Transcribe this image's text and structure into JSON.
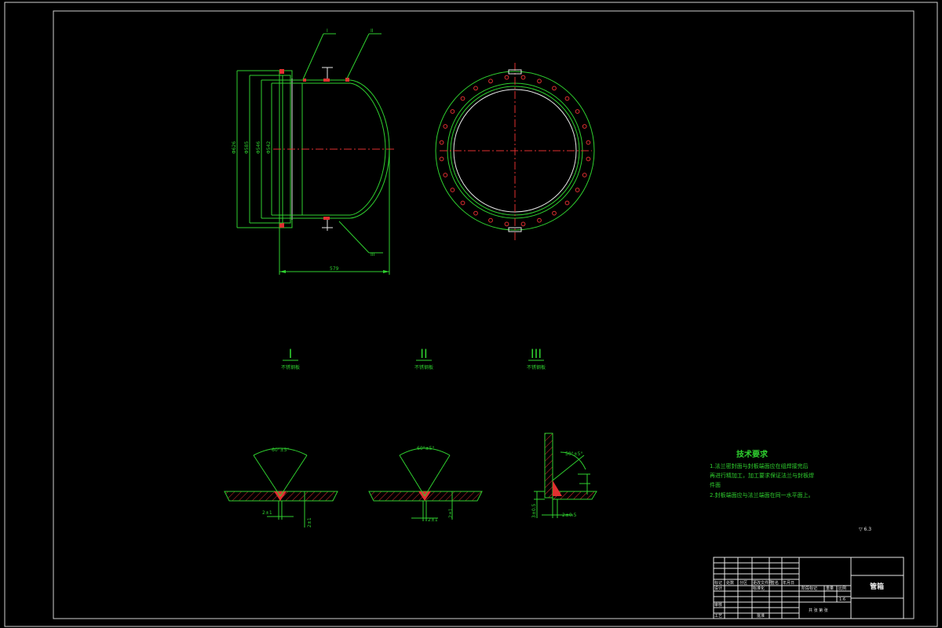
{
  "drawing": {
    "side_view": {
      "dim_outer": "Φ626",
      "dim_2": "Φ585",
      "dim_3": "Φ546",
      "dim_4": "Φ542",
      "dim_length": "579",
      "callout_top_1": "I",
      "callout_top_2": "II",
      "callout_bottom": "III"
    },
    "details": [
      {
        "roman": "I",
        "caption": "不锈钢板",
        "angle": "60°±5°",
        "gap": "2±1",
        "thick": "2±1"
      },
      {
        "roman": "II",
        "caption": "不锈钢板",
        "angle": "60°±5°",
        "gap": "2±1",
        "thick": "2±1"
      },
      {
        "roman": "III",
        "caption": "不锈钢板",
        "angle": "50°±5°",
        "gap": "2±0.5",
        "thick": "3±0.5"
      }
    ],
    "tech_requirements": {
      "title": "技术要求",
      "lines": [
        "1.法兰密封面与封板端面应在组焊接完后",
        "   再进行精加工，加工要求保证法兰与封板焊",
        "   件面",
        "2.封板端面应与法兰端面在同一水平面上。"
      ]
    },
    "roughness": "▽ 6.3"
  },
  "title_block": {
    "title": "管箱",
    "rows": [
      [
        "标记",
        "处数",
        "分区",
        "更改文件号",
        "签名",
        "年月日"
      ],
      [
        "设计",
        "",
        "标准化",
        "",
        "阶段标记",
        "重量",
        "比例"
      ],
      [
        "审核",
        "",
        "",
        "",
        "",
        "",
        "1:6"
      ],
      [
        "工艺",
        "",
        "批准",
        "",
        "共 张 第 张"
      ]
    ]
  },
  "colors": {
    "background": "#000000",
    "object_lines": "#2fd02f",
    "center_lines": "#e03030",
    "frame": "#e8e8e8"
  }
}
